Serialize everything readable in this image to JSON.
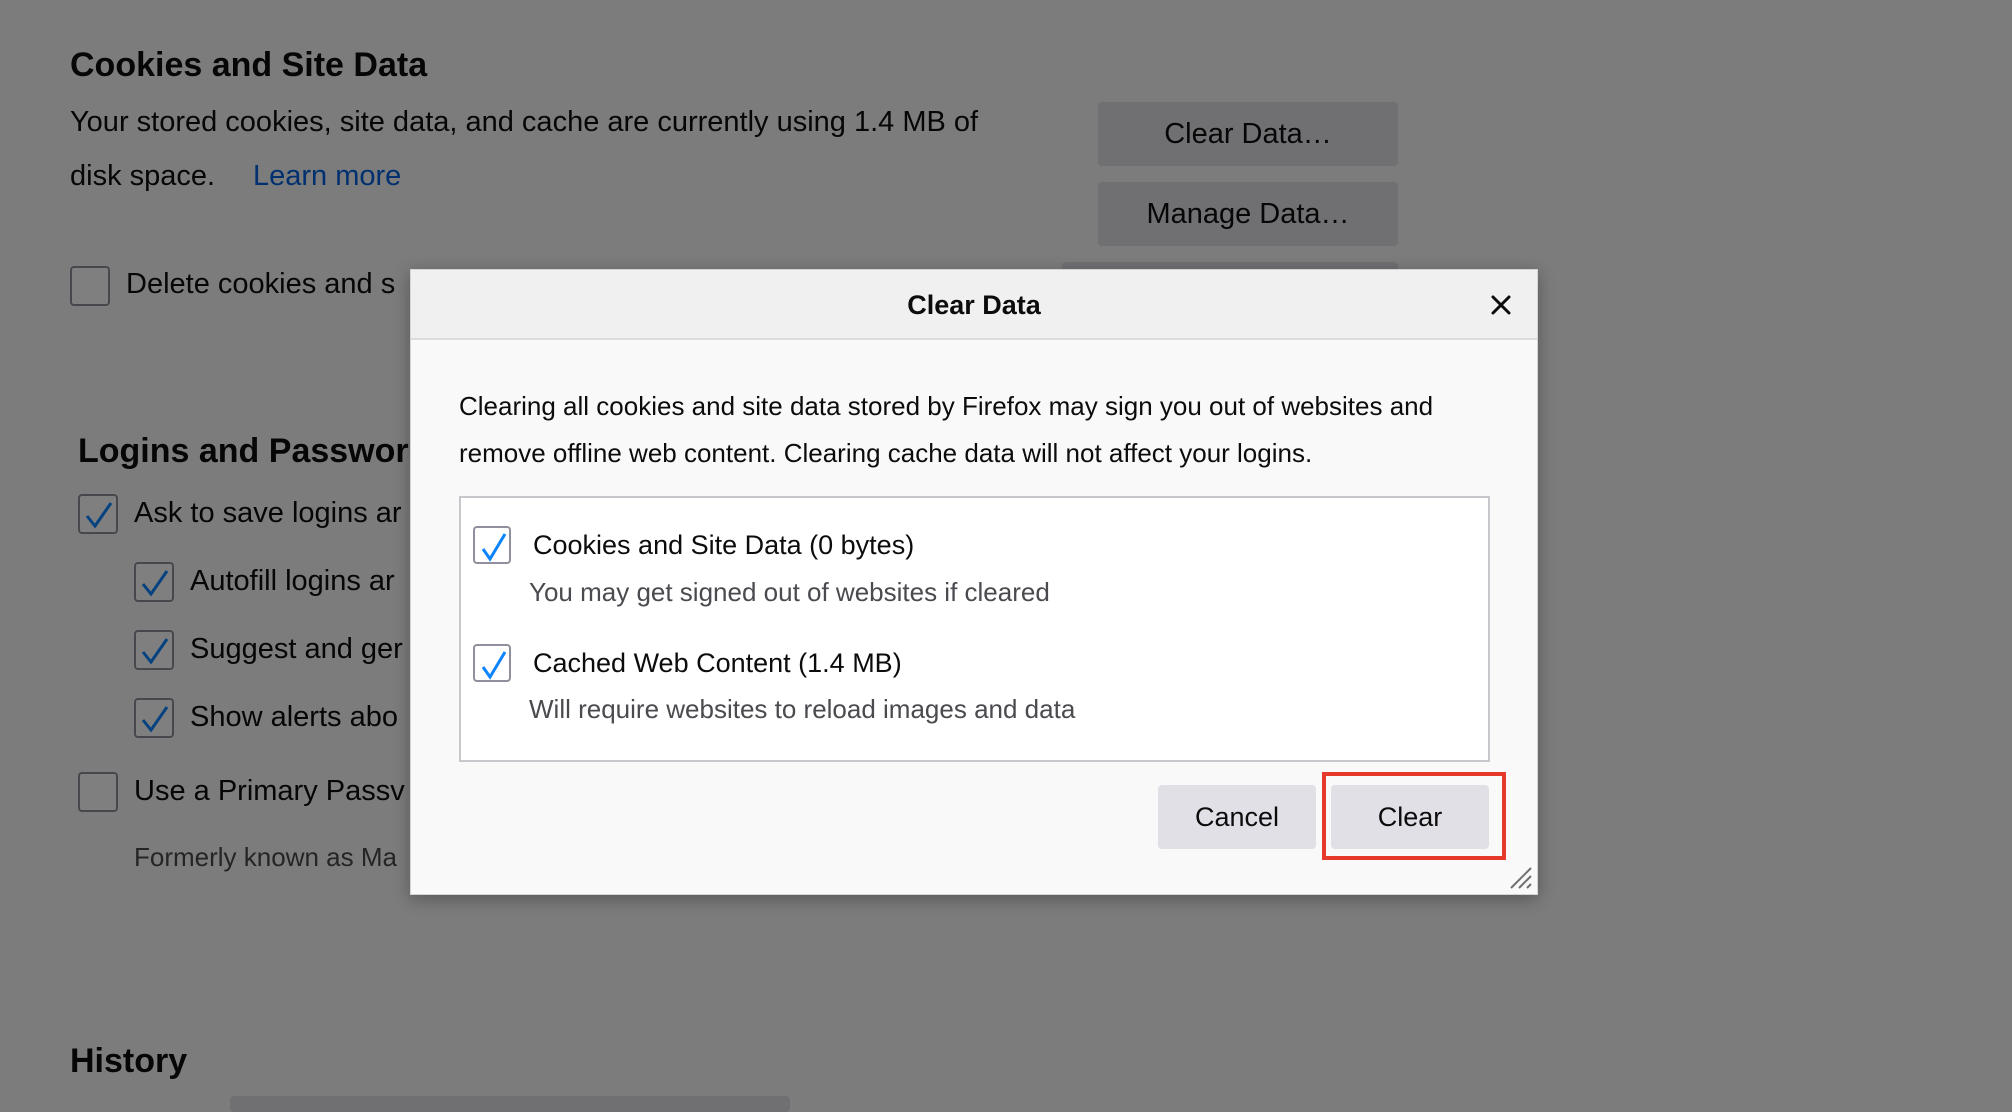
{
  "background": {
    "cookies_section": {
      "title": "Cookies and Site Data",
      "desc_line1": "Your stored cookies, site data, and cache are currently using 1.4 MB of",
      "desc_line2": "disk space.",
      "learn_more": "Learn more",
      "clear_data_button": "Clear Data…",
      "manage_data_button": "Manage Data…",
      "delete_on_close_label": "Delete cookies and s"
    },
    "logins_section": {
      "title": "Logins and Passworc",
      "ask_to_save": "Ask to save logins ar",
      "autofill": "Autofill logins ar",
      "suggest": "Suggest and ger",
      "show_alerts": "Show alerts abo",
      "primary_password": "Use a Primary Passv",
      "formerly_known": "Formerly known as Ma"
    },
    "history_section": {
      "title": "History"
    }
  },
  "dialog": {
    "title": "Clear Data",
    "close_icon": "close-icon",
    "description": "Clearing all cookies and site data stored by Firefox may sign you out of websites and remove offline web content. Clearing cache data will not affect your logins.",
    "options": [
      {
        "label": "Cookies and Site Data (0 bytes)",
        "sublabel": "You may get signed out of websites if cleared",
        "checked": true
      },
      {
        "label": "Cached Web Content (1.4 MB)",
        "sublabel": "Will require websites to reload images and data",
        "checked": true
      }
    ],
    "cancel_label": "Cancel",
    "clear_label": "Clear"
  },
  "colors": {
    "accent_check": "#0a84ff",
    "link": "#0060df",
    "highlight_box": "#e5392b",
    "overlay": "rgba(0,0,0,0.5)"
  }
}
